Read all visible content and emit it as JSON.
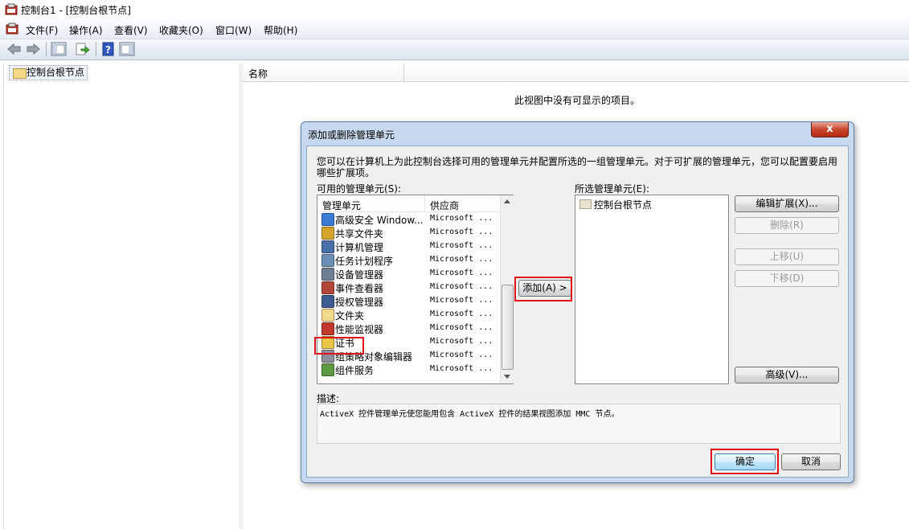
{
  "window": {
    "title": "控制台1 - [控制台根节点]"
  },
  "menu": [
    "文件(F)",
    "操作(A)",
    "查看(V)",
    "收藏夹(O)",
    "窗口(W)",
    "帮助(H)"
  ],
  "toolbar": {
    "icons": [
      "back-arrow-icon",
      "forward-arrow-icon",
      "show-hide-tree-icon",
      "export-list-icon",
      "help-icon",
      "show-hide-action-pane-icon"
    ]
  },
  "tree": {
    "root": "控制台根节点"
  },
  "right_pane": {
    "column_name": "名称",
    "empty_message": "此视图中没有可显示的项目。"
  },
  "dialog": {
    "title": "添加或删除管理单元",
    "close_label": "x",
    "intro_line1": "您可以在计算机上为此控制台选择可用的管理单元并配置所选的一组管理单元。对于可扩展的管理单元，您可以配置要启用",
    "intro_line2": "哪些扩展项。",
    "available_label": "可用的管理单元(S):",
    "available_headers": {
      "name": "管理单元",
      "vendor": "供应商"
    },
    "available_items": [
      {
        "name": "高级安全 Window...",
        "vendor": "Microsoft ...",
        "icon": "firewall-icon",
        "color": "#3a7bd5"
      },
      {
        "name": "共享文件夹",
        "vendor": "Microsoft ...",
        "icon": "shared-folder-icon",
        "color": "#d4a52a"
      },
      {
        "name": "计算机管理",
        "vendor": "Microsoft ...",
        "icon": "computer-management-icon",
        "color": "#4a6fa8"
      },
      {
        "name": "任务计划程序",
        "vendor": "Microsoft ...",
        "icon": "clock-icon",
        "color": "#6c8fb8"
      },
      {
        "name": "设备管理器",
        "vendor": "Microsoft ...",
        "icon": "device-manager-icon",
        "color": "#6e7f93"
      },
      {
        "name": "事件查看器",
        "vendor": "Microsoft ...",
        "icon": "event-viewer-icon",
        "color": "#b5473a"
      },
      {
        "name": "授权管理器",
        "vendor": "Microsoft ...",
        "icon": "authorization-icon",
        "color": "#3d5c8f"
      },
      {
        "name": "文件夹",
        "vendor": "Microsoft ...",
        "icon": "folder-icon",
        "color": "#f3d98a"
      },
      {
        "name": "性能监视器",
        "vendor": "Microsoft ...",
        "icon": "performance-monitor-icon",
        "color": "#c0392b"
      },
      {
        "name": "证书",
        "vendor": "Microsoft ...",
        "icon": "certificate-icon",
        "color": "#e9c44b"
      },
      {
        "name": "组策略对象编辑器",
        "vendor": "Microsoft ...",
        "icon": "group-policy-icon",
        "color": "#8a8f99"
      },
      {
        "name": "组件服务",
        "vendor": "Microsoft ...",
        "icon": "component-services-icon",
        "color": "#5d9a44"
      }
    ],
    "add_button": "添加(A) >",
    "selected_label": "所选管理单元(E):",
    "selected_items": [
      "控制台根节点"
    ],
    "buttons": {
      "edit_extensions": "编辑扩展(X)...",
      "remove": "删除(R)",
      "move_up": "上移(U)",
      "move_down": "下移(D)",
      "advanced": "高级(V)...",
      "ok": "确定",
      "cancel": "取消"
    },
    "description_label": "描述:",
    "description_text": "ActiveX 控件管理单元使您能用包含 ActiveX 控件的结果视图添加 MMC 节点。"
  },
  "colors": {
    "annotation": "#e0101a",
    "dialog_frame": "#c7d9ee",
    "close_button": "#c6452e"
  }
}
